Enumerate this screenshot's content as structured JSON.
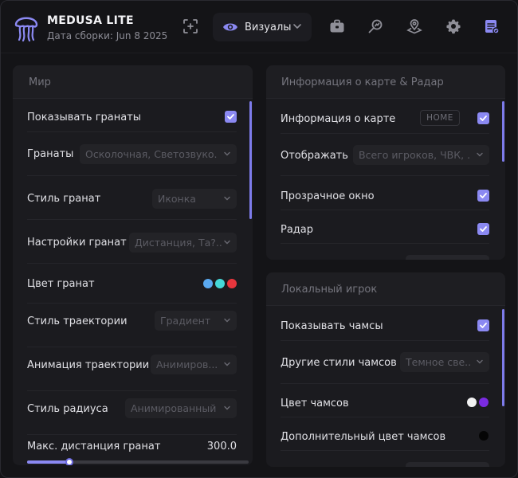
{
  "header": {
    "title": "MEDUSA LITE",
    "build_date": "Дата сборки: Jun 8 2025",
    "tab_label": "Визуалы",
    "icons": [
      "jellyfish-logo",
      "crosshair-icon",
      "eye-icon",
      "chevron-down-icon",
      "briefcase-icon",
      "search-icon",
      "map-pin-icon",
      "gear-icon",
      "config-icon"
    ]
  },
  "world": {
    "title": "Мир",
    "rows": [
      {
        "label": "Показывать гранаты",
        "checked": true
      },
      {
        "label": "Гранаты",
        "value": "Осколочная, Светозвуко..."
      },
      {
        "label": "Стиль гранат",
        "value": "Иконка"
      },
      {
        "label": "Настройки гранат",
        "value": "Дистанция, Та?.."
      },
      {
        "label": "Цвет гранат",
        "colors": [
          "#5aa9f0",
          "#45d8d8",
          "#e8363d"
        ]
      },
      {
        "label": "Стиль траектории",
        "value": "Градиент"
      },
      {
        "label": "Анимация траектории",
        "value": "Анимиров..."
      },
      {
        "label": "Стиль радиуса",
        "value": "Анимированный"
      }
    ],
    "slider": {
      "label": "Макс. дистанция гранат",
      "value": "300.0",
      "fraction": 0.19
    }
  },
  "map_info": {
    "title": "Информация о карте & Радар",
    "rows": [
      {
        "label": "Информация о карте",
        "tag": "HOME",
        "checked": true
      },
      {
        "label": "Отображать",
        "value": "Всего игроков, ЧВК, ..."
      },
      {
        "label": "Прозрачное окно",
        "checked": true
      },
      {
        "label": "Радар",
        "checked": true
      }
    ]
  },
  "local_player": {
    "title": "Локальный игрок",
    "rows": [
      {
        "label": "Показывать чамсы",
        "checked": true
      },
      {
        "label": "Другие стили чамсов",
        "value": "Темное све..."
      },
      {
        "label": "Цвет чамсов",
        "colors": [
          "#f2f2f2",
          "#7a2be0"
        ]
      },
      {
        "label": "Дополнительный цвет чамсов",
        "colors": [
          "#050505"
        ]
      }
    ]
  },
  "colors": {
    "accent": "#8b89f2",
    "background": "#141417",
    "panel": "#1b1b1f"
  }
}
